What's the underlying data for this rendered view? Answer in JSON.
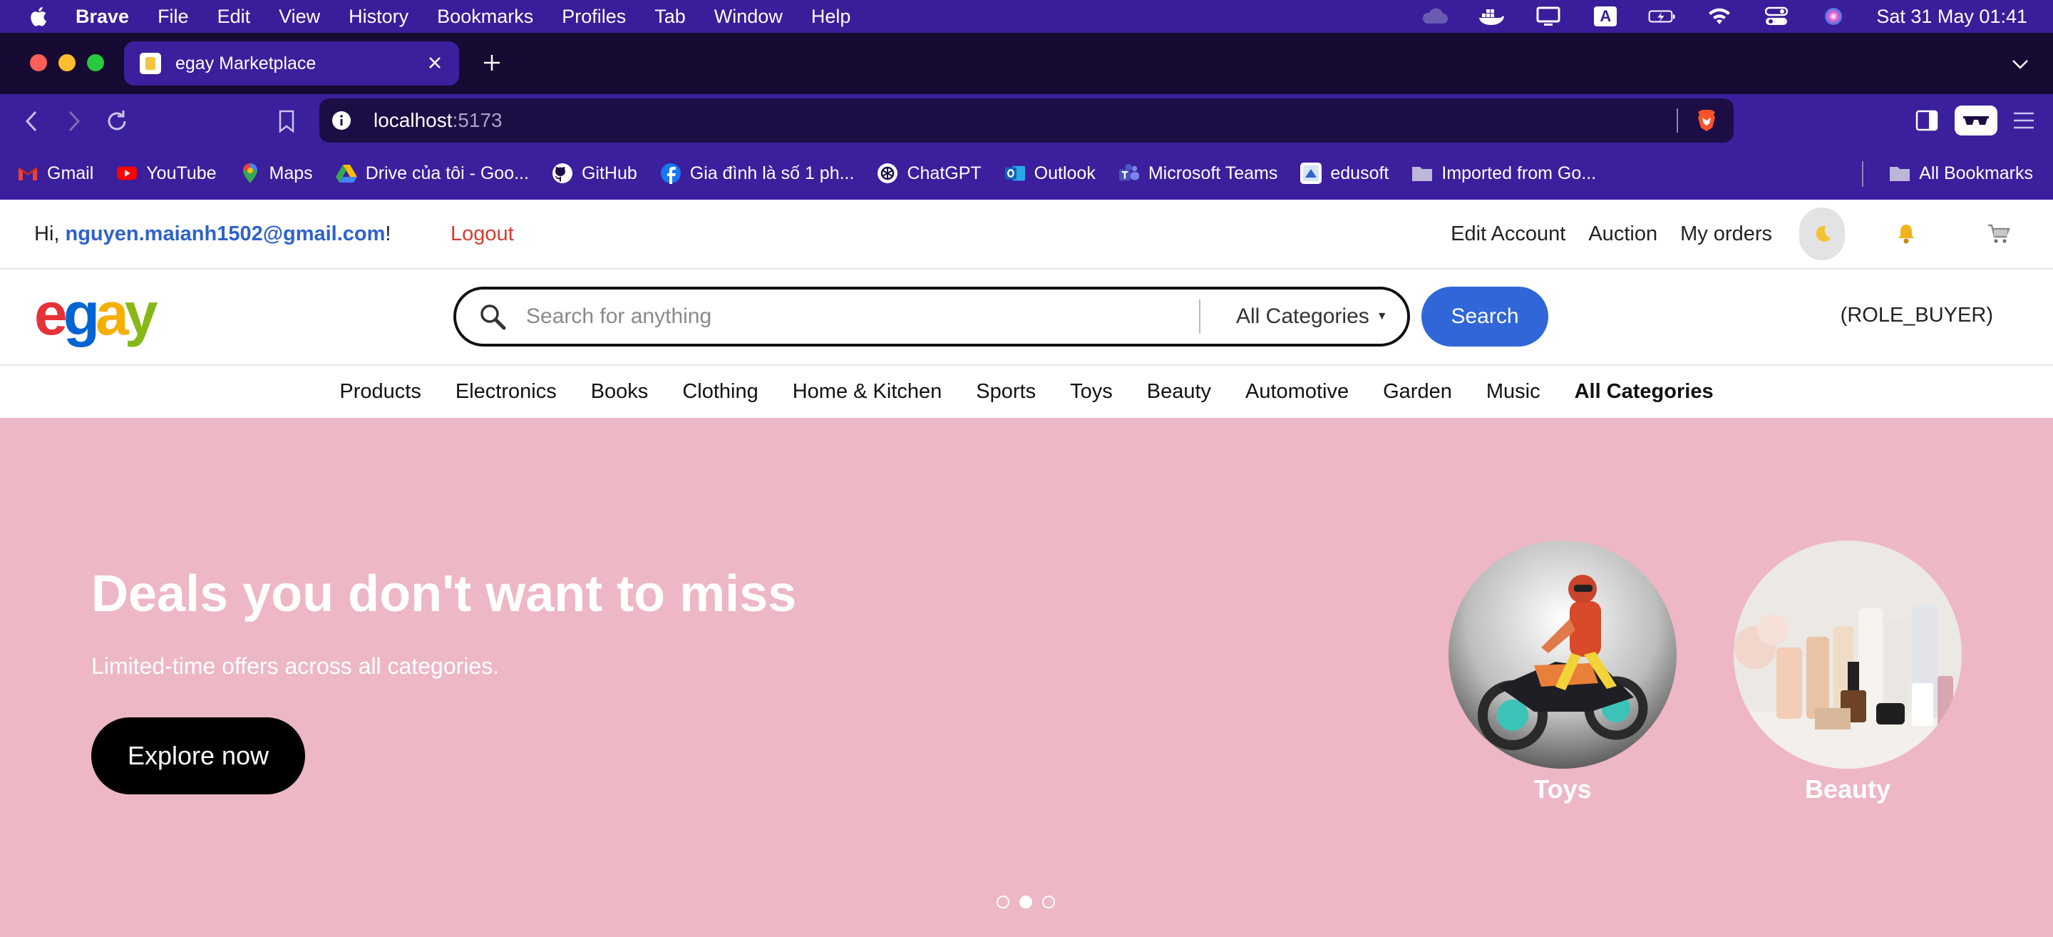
{
  "menubar": {
    "app_name": "Brave",
    "items": [
      "File",
      "Edit",
      "View",
      "History",
      "Bookmarks",
      "Profiles",
      "Tab",
      "Window",
      "Help"
    ],
    "clock": "Sat 31 May  01:41",
    "input_source": "A"
  },
  "browser": {
    "tab_title": "egay Marketplace",
    "url_host": "localhost",
    "url_port": ":5173"
  },
  "bookmarks": {
    "items": [
      {
        "label": "Gmail",
        "icon": "gmail-icon"
      },
      {
        "label": "YouTube",
        "icon": "youtube-icon"
      },
      {
        "label": "Maps",
        "icon": "maps-icon"
      },
      {
        "label": "Drive của tôi - Goo...",
        "icon": "drive-icon"
      },
      {
        "label": "GitHub",
        "icon": "github-icon"
      },
      {
        "label": "Gia đình là số 1 ph...",
        "icon": "facebook-icon"
      },
      {
        "label": "ChatGPT",
        "icon": "chatgpt-icon"
      },
      {
        "label": "Outlook",
        "icon": "outlook-icon"
      },
      {
        "label": "Microsoft Teams",
        "icon": "teams-icon"
      },
      {
        "label": "edusoft",
        "icon": "edusoft-icon"
      },
      {
        "label": "Imported from Go...",
        "icon": "folder-icon"
      }
    ],
    "all_label": "All Bookmarks"
  },
  "header": {
    "greeting_prefix": "Hi, ",
    "user_email": "nguyen.maianh1502@gmail.com",
    "greeting_suffix": "!",
    "logout": "Logout",
    "links": [
      "Edit Account",
      "Auction",
      "My orders"
    ]
  },
  "search": {
    "logo": [
      "e",
      "g",
      "a",
      "y"
    ],
    "placeholder": "Search for anything",
    "category": "All Categories",
    "button": "Search",
    "role": "(ROLE_BUYER)"
  },
  "categories": [
    "Products",
    "Electronics",
    "Books",
    "Clothing",
    "Home & Kitchen",
    "Sports",
    "Toys",
    "Beauty",
    "Automotive",
    "Garden",
    "Music",
    "All Categories"
  ],
  "hero": {
    "title": "Deals you don't want to miss",
    "subtitle": "Limited-time offers across all categories.",
    "cta": "Explore now",
    "cards": [
      "Toys",
      "Beauty"
    ],
    "slide_count": 3,
    "active_slide": 2
  },
  "colors": {
    "menubar": "#3a1d9a",
    "browser_chrome": "#3b1f9d",
    "hero_bg": "#edb7c5",
    "search_button": "#3066d8",
    "email_link": "#2e62c9",
    "logout": "#d93a32"
  }
}
